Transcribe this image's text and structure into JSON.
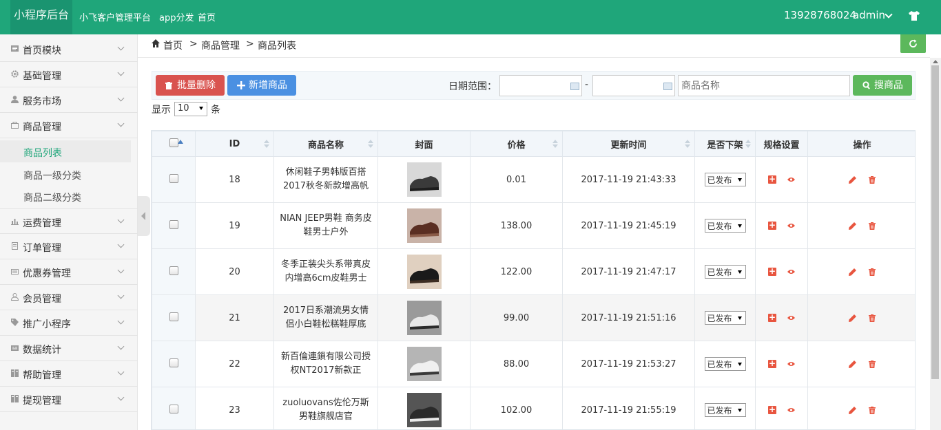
{
  "header": {
    "brand": "小程序后台",
    "nav": [
      "小飞客户管理平台",
      "app分发",
      "首页"
    ],
    "phone": "13928768024",
    "user": "admin"
  },
  "sidebar": {
    "items": [
      {
        "label": "首页模块",
        "icon": "home-module-icon"
      },
      {
        "label": "基础管理",
        "icon": "gear-icon"
      },
      {
        "label": "服务市场",
        "icon": "user-icon"
      },
      {
        "label": "商品管理",
        "icon": "bag-icon"
      },
      {
        "label": "运费管理",
        "icon": "bar-chart-icon"
      },
      {
        "label": "订单管理",
        "icon": "document-icon"
      },
      {
        "label": "优惠券管理",
        "icon": "coupon-icon"
      },
      {
        "label": "会员管理",
        "icon": "member-icon"
      },
      {
        "label": "推广小程序",
        "icon": "tag-icon"
      },
      {
        "label": "数据统计",
        "icon": "stats-icon"
      },
      {
        "label": "帮助管理",
        "icon": "help-icon"
      },
      {
        "label": "提现管理",
        "icon": "withdraw-icon"
      }
    ],
    "sub_items": [
      "商品列表",
      "商品一级分类",
      "商品二级分类"
    ]
  },
  "breadcrumb": [
    "首页",
    "商品管理",
    "商品列表"
  ],
  "breadcrumb_sep": ">",
  "toolbar": {
    "batch_delete": "批量删除",
    "add_product": "新增商品",
    "date_label": "日期范围：",
    "date_dash": "-",
    "name_placeholder": "商品名称",
    "search": "搜商品"
  },
  "show": {
    "prefix": "显示",
    "value": "10",
    "suffix": "条"
  },
  "table": {
    "headers": [
      "ID",
      "商品名称",
      "封面",
      "价格",
      "更新时间",
      "是否下架",
      "规格设置",
      "操作"
    ],
    "rows": [
      {
        "id": "18",
        "name": "休闲鞋子男韩版百搭2017秋冬新款增高帆",
        "price": "0.01",
        "time": "2017-11-19 21:43:33",
        "status": "已发布"
      },
      {
        "id": "19",
        "name": "NIAN JEEP男鞋 商务皮鞋男士户外",
        "price": "138.00",
        "time": "2017-11-19 21:45:19",
        "status": "已发布"
      },
      {
        "id": "20",
        "name": "冬季正装尖头系带真皮内增高6cm皮鞋男士",
        "price": "122.00",
        "time": "2017-11-19 21:47:17",
        "status": "已发布"
      },
      {
        "id": "21",
        "name": "2017日系潮流男女情侣小白鞋松糕鞋厚底",
        "price": "99.00",
        "time": "2017-11-19 21:51:16",
        "status": "已发布"
      },
      {
        "id": "22",
        "name": "新百倫連鎖有限公司授权NT2017新款正",
        "price": "88.00",
        "time": "2017-11-19 21:53:27",
        "status": "已发布"
      },
      {
        "id": "23",
        "name": "zuoluovans佐伦万斯男鞋旗舰店官",
        "price": "102.00",
        "time": "2017-11-19 21:55:19",
        "status": "已发布"
      }
    ]
  },
  "colors": {
    "header": "#1fa67a",
    "danger": "#d9534f",
    "primary": "#4a90e2",
    "success": "#5cb85c"
  }
}
